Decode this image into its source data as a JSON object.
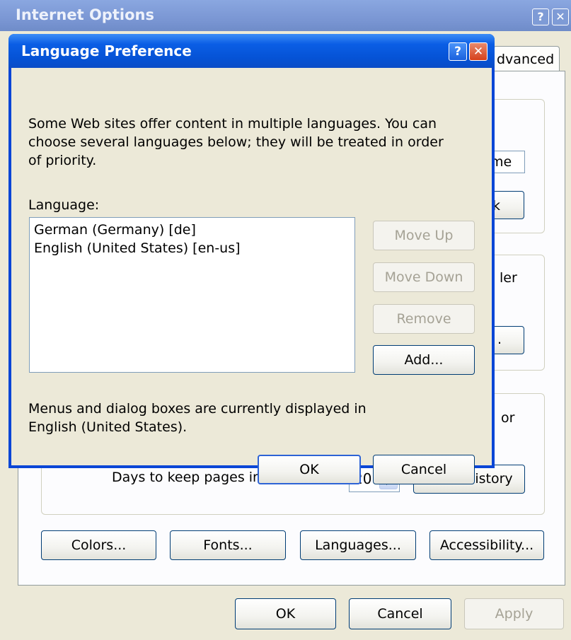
{
  "internet_options": {
    "title": "Internet Options",
    "help_glyph": "?",
    "close_glyph": "✕",
    "visible_tab_fragment": "dvanced",
    "fragments": {
      "home_field": "me",
      "use_button": "k",
      "settings_text": "ler",
      "settings_button": ".",
      "history_text": "or"
    },
    "history": {
      "days_label": "Days to keep pages in history:",
      "days_value": "20",
      "clear_button": "Clear History"
    },
    "bottom_buttons": {
      "colors": "Colors...",
      "fonts": "Fonts...",
      "languages": "Languages...",
      "accessibility": "Accessibility..."
    },
    "footer_buttons": {
      "ok": "OK",
      "cancel": "Cancel",
      "apply": "Apply"
    }
  },
  "language_preference": {
    "title": "Language Preference",
    "help_glyph": "?",
    "close_glyph": "✕",
    "intro": "Some Web sites offer content in multiple languages. You can choose several languages below; they will be treated in order of priority.",
    "language_label": "Language:",
    "languages": [
      "German (Germany) [de]",
      "English (United States) [en-us]"
    ],
    "buttons": {
      "move_up": "Move Up",
      "move_down": "Move Down",
      "remove": "Remove",
      "add": "Add...",
      "ok": "OK",
      "cancel": "Cancel"
    },
    "status": "Menus and dialog boxes are currently displayed in English (United States)."
  }
}
